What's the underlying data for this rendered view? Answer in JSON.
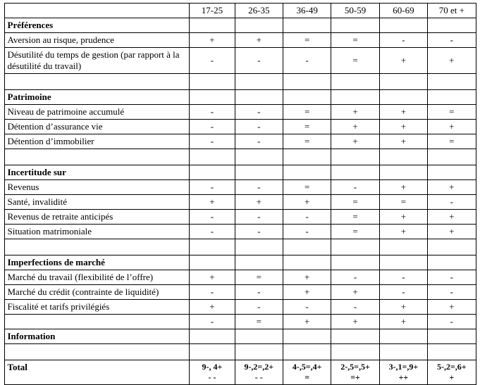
{
  "columns": [
    "17-25",
    "26-35",
    "36-49",
    "50-59",
    "60-69",
    "70 et +"
  ],
  "sections": [
    {
      "title": "Préférences",
      "rows": [
        {
          "label": "Aversion au risque, prudence",
          "vals": [
            "+",
            "+",
            "=",
            "=",
            "-",
            "-"
          ]
        },
        {
          "label": "Désutilité du temps de gestion (par rapport à la désutilité du travail)",
          "vals": [
            "-",
            "-",
            "-",
            "=",
            "+",
            "+"
          ],
          "tall": true
        }
      ]
    },
    {
      "title": "Patrimoine",
      "rows": [
        {
          "label": "Niveau de patrimoine accumulé",
          "vals": [
            "-",
            "-",
            "=",
            "+",
            "+",
            "="
          ]
        },
        {
          "label": "Détention d’assurance vie",
          "vals": [
            "-",
            "-",
            "=",
            "+",
            "+",
            "+"
          ]
        },
        {
          "label": "Détention d’immobilier",
          "vals": [
            "-",
            "-",
            "=",
            "+",
            "+",
            "="
          ]
        }
      ]
    },
    {
      "title": "Incertitude sur",
      "rows": [
        {
          "label": "Revenus",
          "vals": [
            "-",
            "-",
            "=",
            "-",
            "+",
            "+"
          ]
        },
        {
          "label": "Santé, invalidité",
          "vals": [
            "+",
            "+",
            "+",
            "=",
            "=",
            "-"
          ]
        },
        {
          "label": "Revenus de retraite anticipés",
          "vals": [
            "-",
            "-",
            "-",
            "=",
            "+",
            "+"
          ]
        },
        {
          "label": "Situation matrimoniale",
          "vals": [
            "-",
            "-",
            "-",
            "=",
            "+",
            "+"
          ]
        }
      ]
    },
    {
      "title": "Imperfections de marché",
      "rows": [
        {
          "label": "Marché du travail (flexibilité de l’offre)",
          "vals": [
            "+",
            "=",
            "+",
            "-",
            "-",
            "-"
          ]
        },
        {
          "label": "Marché du crédit (contrainte de liquidité)",
          "vals": [
            "-",
            "-",
            "+",
            "+",
            "-",
            "-"
          ]
        },
        {
          "label": "Fiscalité et tarifs privilégiés",
          "vals": [
            "+",
            "-",
            "-",
            "-",
            "+",
            "+"
          ]
        }
      ],
      "trailing": {
        "label": "",
        "vals": [
          "-",
          "=",
          "+",
          "+",
          "+",
          "-"
        ]
      },
      "footer_label": "Information"
    }
  ],
  "total": {
    "label": "Total",
    "vals": [
      "9-, 4+\n- -",
      "9-,2=,2+\n- -",
      "4-,5=,4+\n=",
      "2-,5=,5+\n=+",
      "3-,1=,9+\n++",
      "5-,2=,6+\n+"
    ]
  }
}
